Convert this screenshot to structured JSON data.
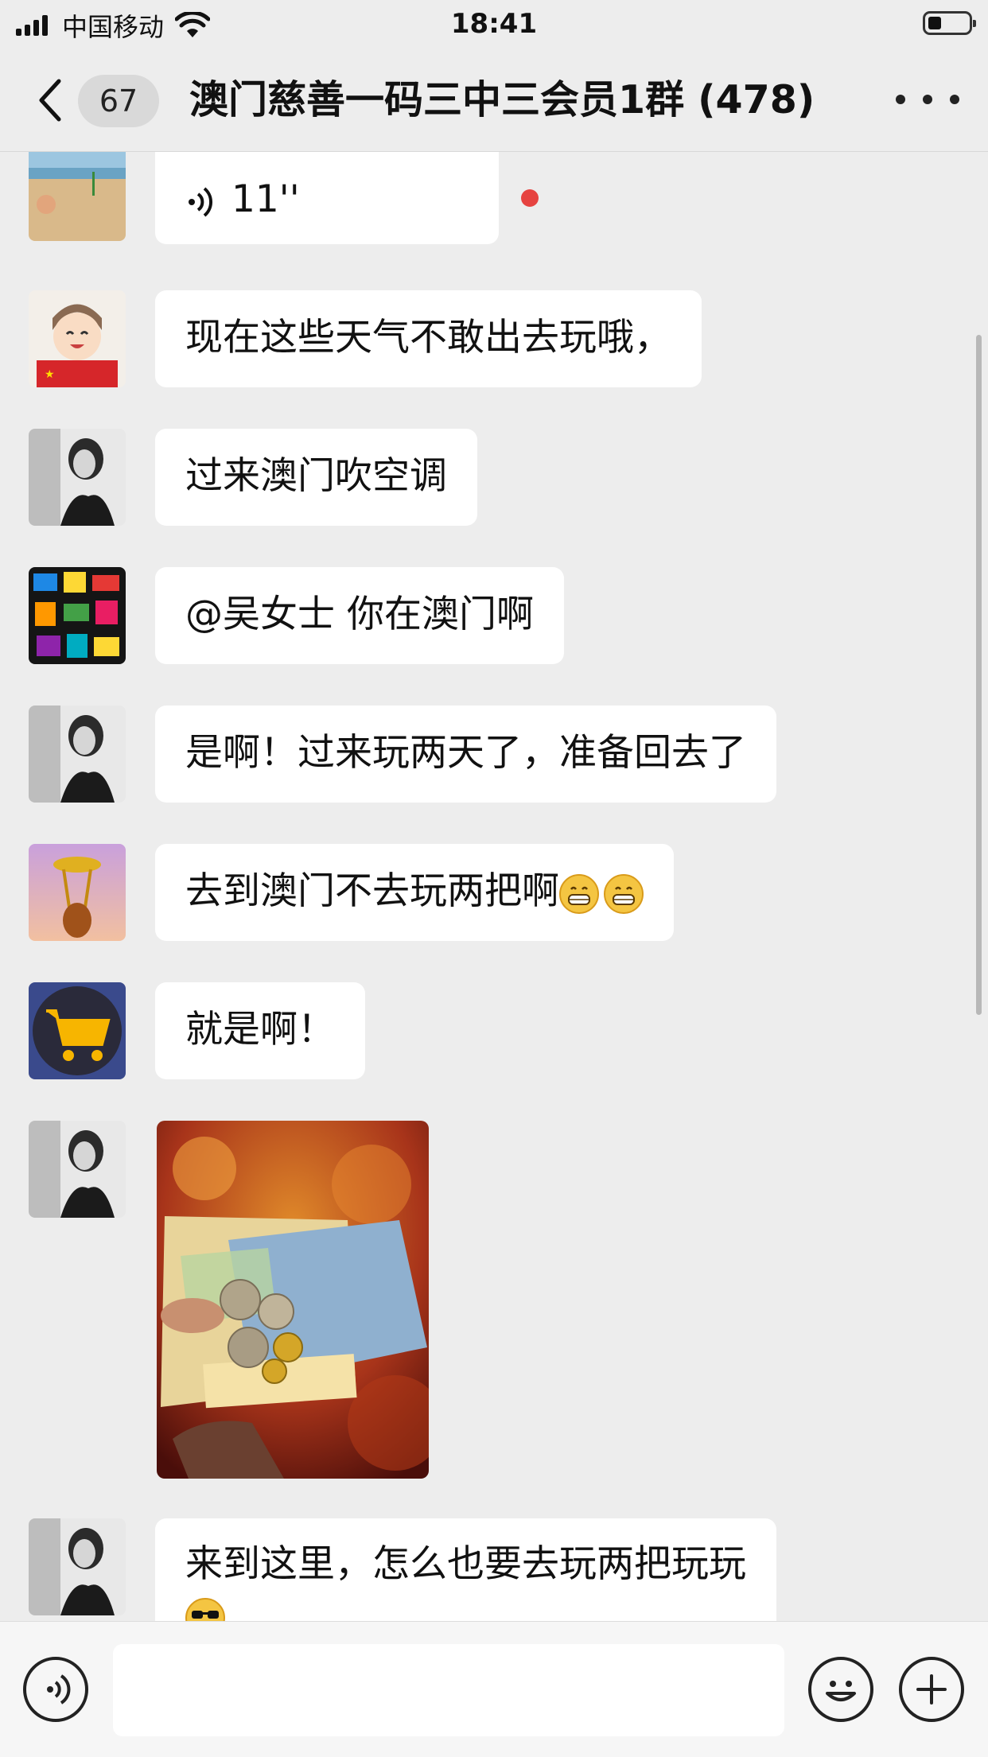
{
  "status_bar": {
    "carrier": "中国移动",
    "time": "18:41"
  },
  "nav": {
    "unread_badge": "67",
    "title": "澳门慈善一码三中三会员1群 (478)"
  },
  "messages": [
    {
      "type": "voice",
      "duration": "11''",
      "avatar": "beach-photo-avatar"
    },
    {
      "type": "text",
      "text": "现在这些天气不敢出去玩哦，",
      "avatar": "cartoon-boy-avatar"
    },
    {
      "type": "text",
      "text": "过来澳门吹空调",
      "avatar": "woman-bw-avatar"
    },
    {
      "type": "text",
      "text": "@吴女士 你在澳门啊",
      "avatar": "colorful-toys-avatar"
    },
    {
      "type": "text",
      "text": "是啊！过来玩两天了，准备回去了",
      "avatar": "woman-bw-avatar"
    },
    {
      "type": "text",
      "text": "去到澳门不去玩两把啊",
      "emoji": "grinning-emoji-x2",
      "avatar": "golden-figure-avatar"
    },
    {
      "type": "text",
      "text": "就是啊！",
      "avatar": "shopping-cart-avatar"
    },
    {
      "type": "image",
      "description_icon": "banknotes-coins-photo",
      "avatar": "woman-bw-avatar"
    },
    {
      "type": "text",
      "text": "来到这里，怎么也要去玩两把玩玩",
      "emoji": "sunglasses-emoji",
      "avatar": "woman-bw-avatar"
    }
  ],
  "input_bar": {
    "voice_icon": "voice-mode-icon",
    "emoji_icon": "emoji-icon",
    "plus_icon": "plus-icon"
  },
  "colors": {
    "background": "#ededed",
    "bubble": "#ffffff",
    "unread_dot": "#e64340"
  }
}
